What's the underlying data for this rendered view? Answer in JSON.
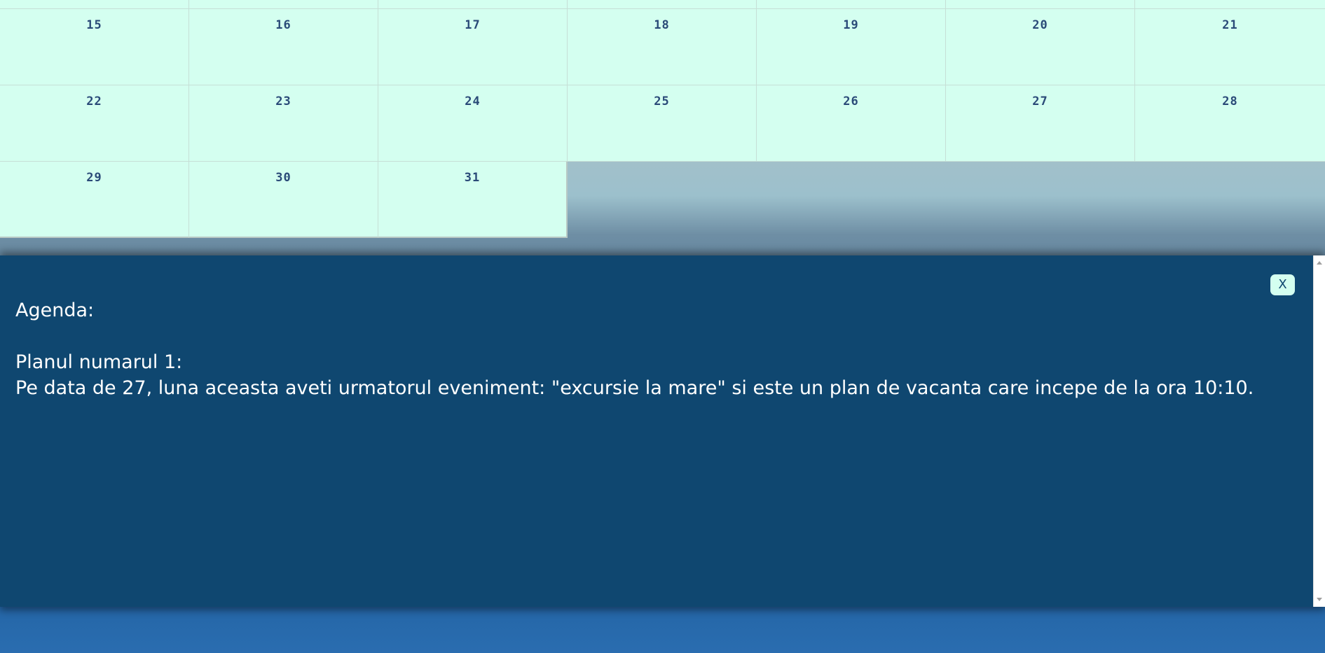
{
  "calendar": {
    "rows": [
      [
        "15",
        "16",
        "17",
        "18",
        "19",
        "20",
        "21"
      ],
      [
        "22",
        "23",
        "24",
        "25",
        "26",
        "27",
        "28"
      ],
      [
        "29",
        "30",
        "31"
      ]
    ]
  },
  "agenda": {
    "title": "Agenda:",
    "plan_heading": "Planul numarul 1:",
    "plan_text": "Pe data de 27, luna aceasta aveti urmatorul eveniment: \"excursie la mare\" si este un plan de vacanta care incepe de la ora 10:10.",
    "close_label": "X"
  }
}
